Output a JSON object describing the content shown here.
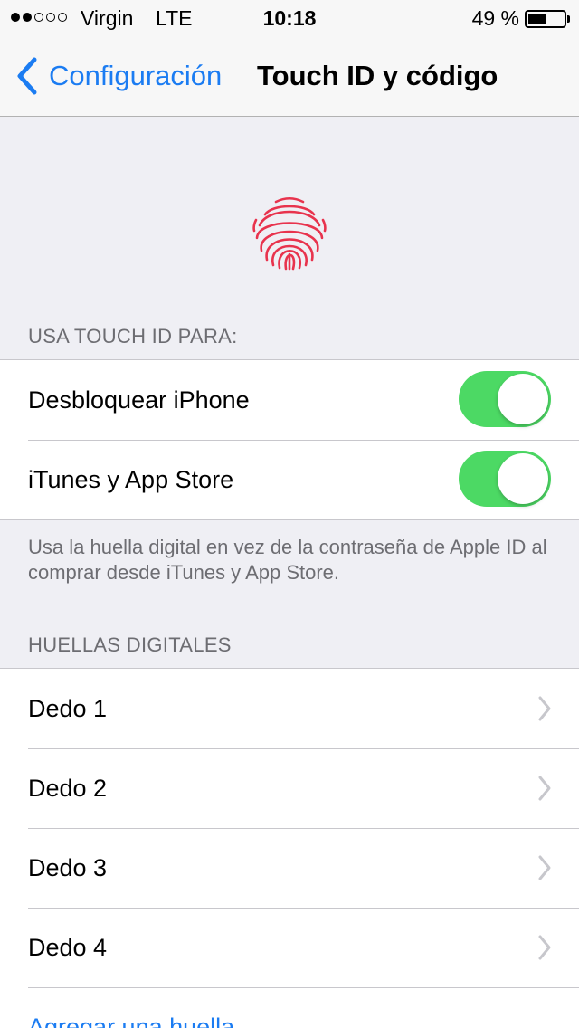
{
  "status_bar": {
    "signal_filled": 2,
    "signal_total": 5,
    "carrier": "Virgin",
    "network": "LTE",
    "time": "10:18",
    "battery_percent": "49 %",
    "battery_level": 0.49
  },
  "nav": {
    "back_label": "Configuración",
    "title": "Touch ID y código",
    "accent_color": "#1b7cf2"
  },
  "header_icon": "fingerprint-icon",
  "touch_id_section": {
    "header": "USA TOUCH ID PARA:",
    "rows": [
      {
        "label": "Desbloquear iPhone",
        "enabled": true
      },
      {
        "label": "iTunes y App Store",
        "enabled": true
      }
    ],
    "footer": "Usa la huella digital en vez de la contraseña de Apple ID al comprar desde iTunes y App Store.",
    "toggle_color": "#4cd964"
  },
  "fingerprints_section": {
    "header": "HUELLAS DIGITALES",
    "rows": [
      {
        "label": "Dedo 1"
      },
      {
        "label": "Dedo 2"
      },
      {
        "label": "Dedo 3"
      },
      {
        "label": "Dedo 4"
      }
    ],
    "add_label": "Agregar una huella..."
  }
}
